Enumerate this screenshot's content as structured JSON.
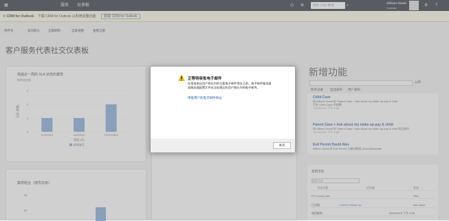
{
  "nav": {
    "menu": "服务",
    "sub": "仪表板",
    "search_placeholder": "搜索 CRM 数据",
    "user_name": "Allison Guest",
    "user_org": "Contoso"
  },
  "notice": {
    "app": "CRM for Outlook",
    "text": "下载 CRM for Outlook 以利用完整功能",
    "button": "获取 CRM for Outlook"
  },
  "commands": [
    "另存为",
    "设为默认",
    "全部刷新",
    "全屏视图",
    "查看全部"
  ],
  "dashboard_title": "客户服务代表社交仪表板",
  "chart1": {
    "title": "我最近一周的 SLA 状态的案例",
    "subtitle": "按状态分组",
    "legend": "即将发生"
  },
  "chart2": {
    "title": "案例组合（按优先级）"
  },
  "chart_data": {
    "type": "bar",
    "categories": [
      "11/9/2015",
      "6/9/2015",
      "13/10/2015"
    ],
    "values": [
      1,
      1,
      2
    ],
    "ylim": [
      0,
      3
    ],
    "ylabel": "记录 (数量)",
    "xlabel": "提起 (天)",
    "series": [
      {
        "name": "即将发生",
        "values": [
          1,
          1,
          2
        ]
      }
    ]
  },
  "whats_new": {
    "title": "新增功能",
    "tabs": [
      "所有记录",
      "自动发布",
      "用户发布"
    ],
    "items": [
      {
        "title": "Child Case",
        "line1": "由 Allison Guest 在 Parent Case + Ask about my make up pay & child",
        "line2": "已在 Child Case 中创建",
        "time": "13/10/2015 下午 4:08"
      },
      {
        "title": "Parent Case + Ask about my make up pay & child",
        "line1": "由 Allison Guest 在 Parent Case + Ask about my make up pay & child 的记录中",
        "line2": "",
        "time": "13/10/2015 下午 4:08"
      },
      {
        "title": "Exit Permit David Alex",
        "line1": "Allison Guest 在 Exit Permit 上被分配给 David Alexander",
        "line2": "",
        "time": "13/10/2015 下午 4:08"
      }
    ]
  },
  "table": {
    "filter": "案例活动",
    "search": "搜索记录",
    "headers": [
      "活动主题",
      "优先级",
      "状态"
    ],
    "rows": [
      [
        "PO Survey Act…",
        "",
        "Text"
      ],
      [
        "已分配",
        "I need to follow up",
        "Ask Upon"
      ],
      [
        "电话联系",
        "",
        "13/10/2015 下午 4:08"
      ]
    ]
  },
  "dialog": {
    "title": "正等待审批电子邮件",
    "body": "在批准来自用户和队列的主要电子邮件地址之前，电子邮件服务器或服务器配置文件无法处理这些用户和队列的电子邮件。",
    "link": "审批用户的电子邮件地址",
    "close": "关闭"
  },
  "colors": {
    "accent": "#1f5ea8",
    "nav": "#262b36",
    "bar": "#7fa6d8",
    "warning": "#f2c200"
  }
}
